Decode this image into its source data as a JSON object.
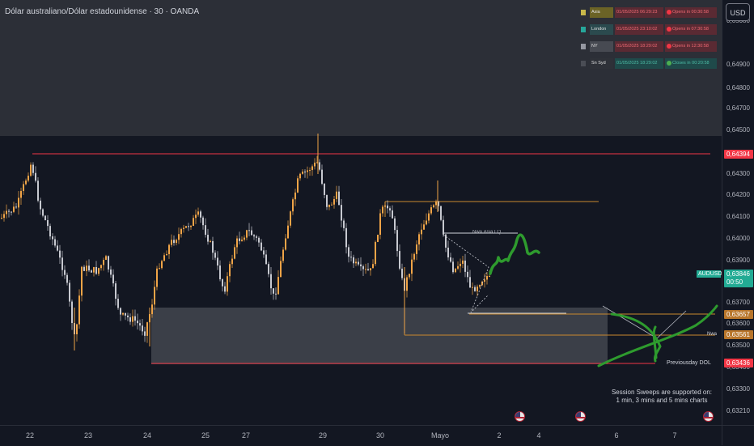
{
  "title": "Dólar australiano/Dólar estadounidense · 30 · OANDA",
  "currency_button": "USD",
  "price_ticks": [
    "0,65080",
    "0,64900",
    "0,64800",
    "0,64700",
    "0,64500",
    "0,64300",
    "0,64200",
    "0,64100",
    "0,64000",
    "0,63900",
    "0,63700",
    "0,63600",
    "0,63500",
    "0,63400",
    "0,63300",
    "0,63210"
  ],
  "badges": {
    "top_level": {
      "value": "0,64394",
      "color": "#f23645"
    },
    "symbol": {
      "name": "AUDUSD",
      "value": "0,63846",
      "countdown": "00:50",
      "color": "#22ab94"
    },
    "level_orange_1": {
      "value": "0,63657",
      "color": "#b8752a"
    },
    "level_orange_2": {
      "value": "0,63561",
      "color": "#b8752a"
    },
    "level_red": {
      "value": "0,63436",
      "color": "#f23645"
    }
  },
  "time_labels": [
    "22",
    "23",
    "24",
    "25",
    "27",
    "29",
    "30",
    "Mayo",
    "2",
    "4",
    "6",
    "7"
  ],
  "sessions": [
    {
      "name": "Asia",
      "time": "01/05/2025 06:29:23",
      "status": "Opens in 00:30:58",
      "name_bg": "#6b6326",
      "time_bg": "#5a2a33",
      "status_bg": "#5a2a33",
      "dot": "#c8b84a",
      "status_dot": "#f23645",
      "text": "#f26a74"
    },
    {
      "name": "London",
      "time": "01/05/2025 23:10:02",
      "status": "Opens in 07:30:58",
      "name_bg": "#2b4a4e",
      "time_bg": "#5a2a33",
      "status_bg": "#5a2a33",
      "dot": "#26a69a",
      "status_dot": "#f23645",
      "text": "#f26a74"
    },
    {
      "name": "NY",
      "time": "01/05/2025 18:29:02",
      "status": "Opens in 12:30:58",
      "name_bg": "#474a52",
      "time_bg": "#5a2a33",
      "status_bg": "#5a2a33",
      "dot": "#9598a1",
      "status_dot": "#f23645",
      "text": "#f26a74"
    },
    {
      "name": "Sn Syd",
      "time": "01/05/2025 18:29:02",
      "status": "Closes in 00:20:58",
      "name_bg": "#2e3138",
      "time_bg": "#1f4a4a",
      "status_bg": "#1f4a4a",
      "dot": "#4a4d55",
      "status_dot": "#4caf50",
      "text": "#4dbfa8"
    }
  ],
  "chart_labels": {
    "low_label": "Nwa.Asia LQ",
    "mid_label": "Nwa",
    "tf_label": "Previousday DOL"
  },
  "sweeps_note": [
    "Session Sweeps are supported on:",
    "1 min, 3 mins and 5 mins charts"
  ],
  "colors": {
    "up": "#f0a447",
    "down": "#c7c9d0",
    "resistance": "#f23645",
    "orange_line": "#c98a2e",
    "drawing": "#2e9b2e",
    "zone": "#4a4d55"
  }
}
